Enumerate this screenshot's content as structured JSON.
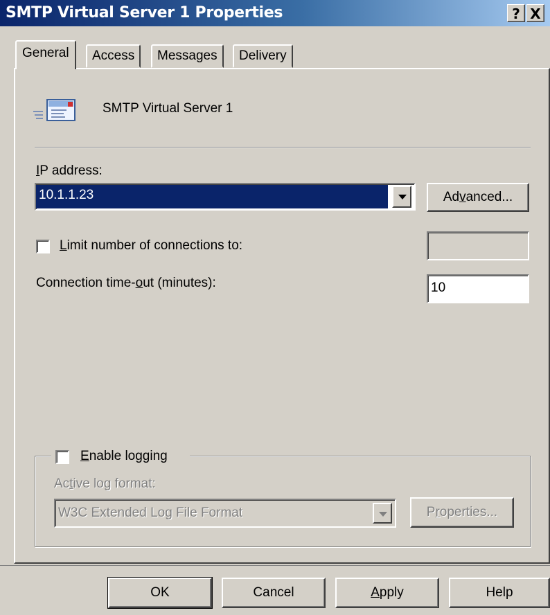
{
  "window": {
    "title": "SMTP Virtual Server 1 Properties",
    "help_button": "?",
    "close_button": "X"
  },
  "tabs": [
    {
      "label": "General",
      "active": true
    },
    {
      "label": "Access",
      "active": false
    },
    {
      "label": "Messages",
      "active": false
    },
    {
      "label": "Delivery",
      "active": false
    }
  ],
  "general": {
    "server_icon": "smtp-envelope-icon",
    "server_name": "SMTP Virtual Server 1",
    "ip_label_mnemonic": "I",
    "ip_label_rest": "P address:",
    "ip_value": "10.1.1.23",
    "advanced_pre": "Ad",
    "advanced_mnemonic": "v",
    "advanced_post": "anced...",
    "limit_mnemonic": "L",
    "limit_rest": "imit number of connections to:",
    "limit_checked": false,
    "limit_value": "",
    "timeout_pre": "Connection time-",
    "timeout_mnemonic": "o",
    "timeout_post": "ut (minutes):",
    "timeout_value": "10"
  },
  "logging": {
    "enable_mnemonic": "E",
    "enable_rest": "nable logging",
    "enable_checked": false,
    "format_pre": "Ac",
    "format_mnemonic": "t",
    "format_post": "ive log format:",
    "format_value": "W3C Extended Log File Format",
    "properties_pre": "P",
    "properties_mnemonic": "r",
    "properties_post": "operties..."
  },
  "buttons": {
    "ok": "OK",
    "cancel": "Cancel",
    "apply_mnemonic": "A",
    "apply_rest": "pply",
    "help": "Help"
  },
  "colors": {
    "titlebar_start": "#0a246a",
    "titlebar_end": "#a6caf0",
    "face": "#d4d0c8",
    "selection": "#0a246a"
  }
}
